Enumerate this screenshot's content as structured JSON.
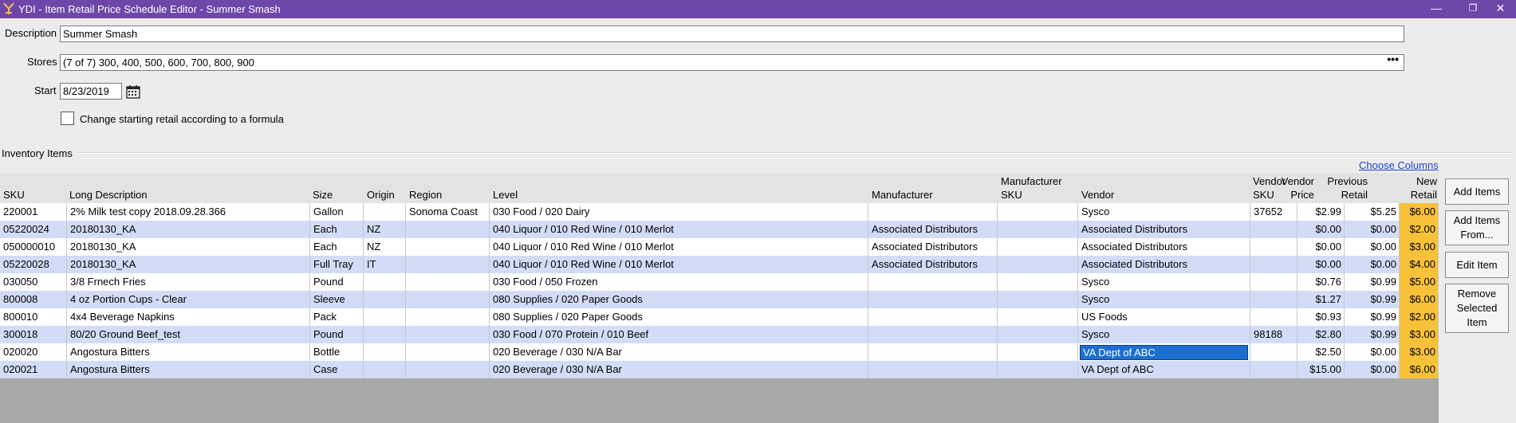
{
  "window": {
    "title": "YDI - Item Retail Price Schedule Editor - Summer Smash",
    "app_icon": "ydi-app-icon",
    "controls": {
      "minimize": "—",
      "restore": "❐",
      "close": "✕"
    }
  },
  "form": {
    "description_label": "Description",
    "description_value": "Summer Smash",
    "stores_label": "Stores",
    "stores_value": "(7 of 7) 300, 400, 500, 600, 700, 800, 900",
    "stores_more": "•••",
    "start_label": "Start",
    "start_value": "8/23/2019",
    "formula_checkbox_label": "Change starting retail according to a formula",
    "formula_checked": false
  },
  "inventory": {
    "section_label": "Inventory Items",
    "choose_columns_link": "Choose Columns",
    "columns": {
      "sku": "SKU",
      "long_description": "Long Description",
      "size": "Size",
      "origin": "Origin",
      "region": "Region",
      "level": "Level",
      "manufacturer": "Manufacturer",
      "manufacturer_sku_1": "Manufacturer",
      "manufacturer_sku_2": "SKU",
      "vendor": "Vendor",
      "vendor_sku_1": "Vendor",
      "vendor_sku_2": "SKU",
      "vendor_price_1": "Vendor",
      "vendor_price_2": "Price",
      "previous_retail_1": "Previous",
      "previous_retail_2": "Retail",
      "new_retail_1": "New",
      "new_retail_2": "Retail"
    },
    "rows": [
      {
        "sku": "220001",
        "desc": "2% Milk test copy 2018.09.28.366",
        "size": "Gallon",
        "origin": "",
        "region": "Sonoma Coast",
        "level": "030 Food / 020 Dairy",
        "manufacturer": "",
        "mfr_sku": "",
        "vendor": "Sysco",
        "vendor_sku": "37652",
        "vendor_price": "$2.99",
        "prev_retail": "$5.25",
        "new_retail": "$6.00"
      },
      {
        "sku": "05220024",
        "desc": "20180130_KA",
        "size": "Each",
        "origin": "NZ",
        "region": "",
        "level": "040 Liquor / 010 Red Wine / 010 Merlot",
        "manufacturer": "Associated Distributors",
        "mfr_sku": "",
        "vendor": "Associated Distributors",
        "vendor_sku": "",
        "vendor_price": "$0.00",
        "prev_retail": "$0.00",
        "new_retail": "$2.00"
      },
      {
        "sku": "050000010",
        "desc": "20180130_KA",
        "size": "Each",
        "origin": "NZ",
        "region": "",
        "level": "040 Liquor / 010 Red Wine / 010 Merlot",
        "manufacturer": "Associated Distributors",
        "mfr_sku": "",
        "vendor": "Associated Distributors",
        "vendor_sku": "",
        "vendor_price": "$0.00",
        "prev_retail": "$0.00",
        "new_retail": "$3.00"
      },
      {
        "sku": "05220028",
        "desc": "20180130_KA",
        "size": "Full Tray",
        "origin": "IT",
        "region": "",
        "level": "040 Liquor / 010 Red Wine / 010 Merlot",
        "manufacturer": "Associated Distributors",
        "mfr_sku": "",
        "vendor": "Associated Distributors",
        "vendor_sku": "",
        "vendor_price": "$0.00",
        "prev_retail": "$0.00",
        "new_retail": "$4.00"
      },
      {
        "sku": "030050",
        "desc": "3/8 Frnech Fries",
        "size": "Pound",
        "origin": "",
        "region": "",
        "level": "030 Food / 050 Frozen",
        "manufacturer": "",
        "mfr_sku": "",
        "vendor": "Sysco",
        "vendor_sku": "",
        "vendor_price": "$0.76",
        "prev_retail": "$0.99",
        "new_retail": "$5.00"
      },
      {
        "sku": "800008",
        "desc": "4 oz Portion Cups - Clear",
        "size": "Sleeve",
        "origin": "",
        "region": "",
        "level": "080 Supplies / 020 Paper Goods",
        "manufacturer": "",
        "mfr_sku": "",
        "vendor": "Sysco",
        "vendor_sku": "",
        "vendor_price": "$1.27",
        "prev_retail": "$0.99",
        "new_retail": "$6.00"
      },
      {
        "sku": "800010",
        "desc": "4x4 Beverage Napkins",
        "size": "Pack",
        "origin": "",
        "region": "",
        "level": "080 Supplies / 020 Paper Goods",
        "manufacturer": "",
        "mfr_sku": "",
        "vendor": "US Foods",
        "vendor_sku": "",
        "vendor_price": "$0.93",
        "prev_retail": "$0.99",
        "new_retail": "$2.00"
      },
      {
        "sku": "300018",
        "desc": "80/20 Ground Beef_test",
        "size": "Pound",
        "origin": "",
        "region": "",
        "level": "030 Food / 070 Protein / 010 Beef",
        "manufacturer": "",
        "mfr_sku": "",
        "vendor": "Sysco",
        "vendor_sku": "98188",
        "vendor_price": "$2.80",
        "prev_retail": "$0.99",
        "new_retail": "$3.00"
      },
      {
        "sku": "020020",
        "desc": "Angostura Bitters",
        "size": "Bottle",
        "origin": "",
        "region": "",
        "level": "020 Beverage / 030 N/A Bar",
        "manufacturer": "",
        "mfr_sku": "",
        "vendor": "VA Dept of ABC",
        "vendor_sku": "",
        "vendor_price": "$2.50",
        "prev_retail": "$0.00",
        "new_retail": "$3.00",
        "selected_vendor": true
      },
      {
        "sku": "020021",
        "desc": "Angostura Bitters",
        "size": "Case",
        "origin": "",
        "region": "",
        "level": "020 Beverage / 030 N/A Bar",
        "manufacturer": "",
        "mfr_sku": "",
        "vendor": "VA Dept of ABC",
        "vendor_sku": "",
        "vendor_price": "$15.00",
        "prev_retail": "$0.00",
        "new_retail": "$6.00"
      }
    ]
  },
  "buttons": {
    "add_items": "Add Items",
    "add_items_from": "Add Items From...",
    "edit_item": "Edit Item",
    "remove_selected_item": "Remove Selected Item"
  },
  "colors": {
    "titlebar": "#6f47a8",
    "row_alt": "#d2dcf7",
    "new_retail_highlight": "#f7c23a",
    "selection": "#1c6fd0"
  }
}
